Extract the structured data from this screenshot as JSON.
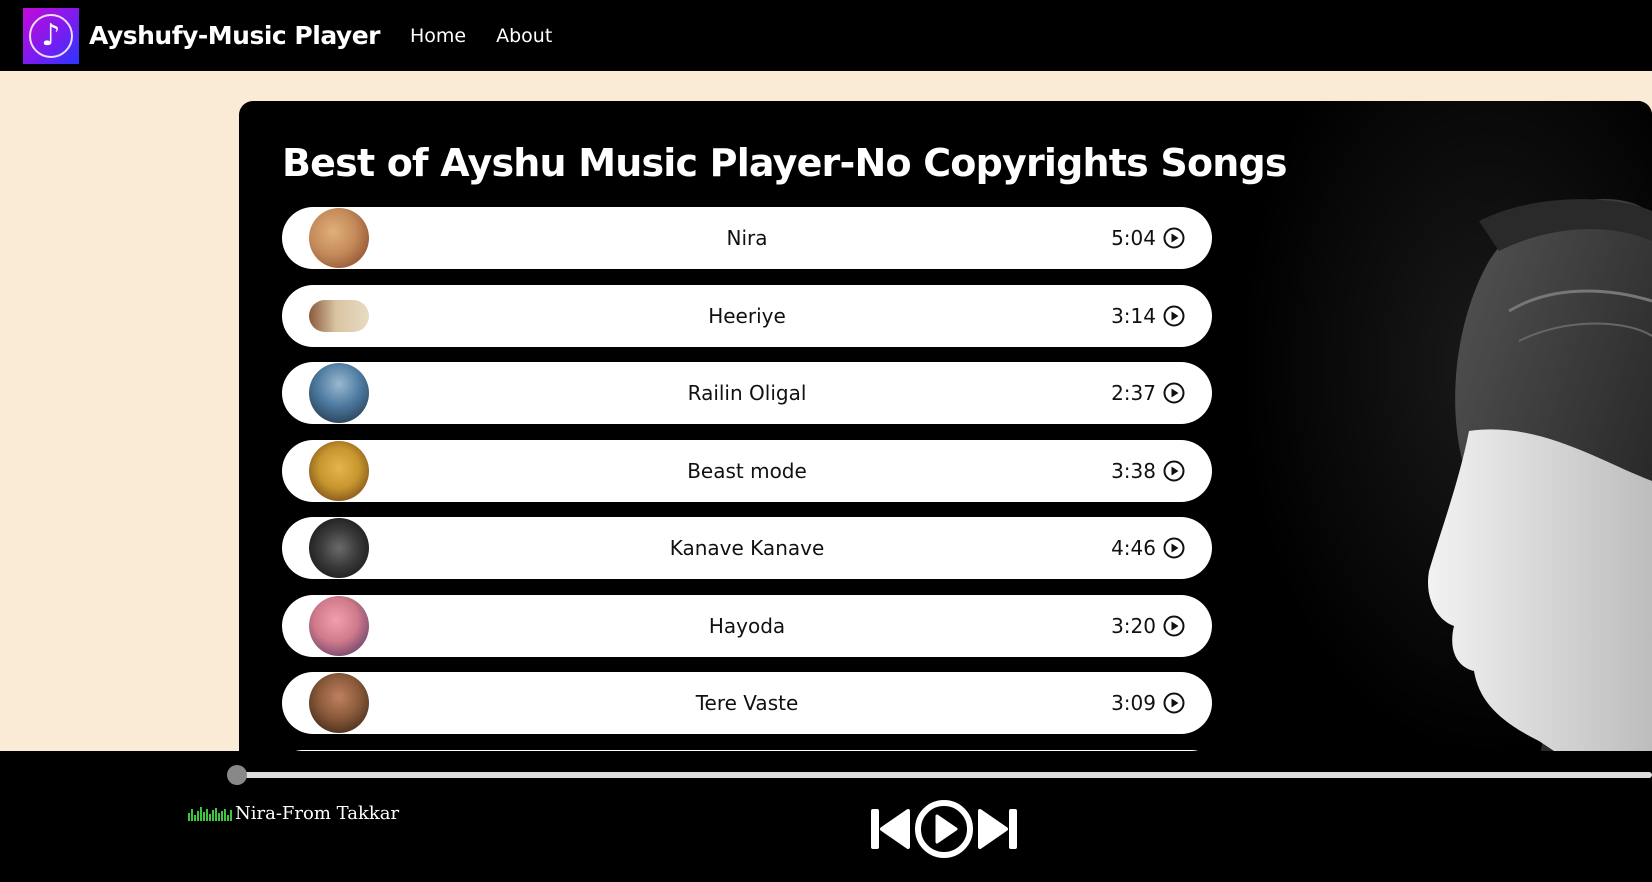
{
  "navbar": {
    "brand": "Ayshufy-Music Player",
    "links": [
      {
        "label": "Home"
      },
      {
        "label": "About"
      }
    ],
    "logo_icon": "music-note-icon"
  },
  "main": {
    "heading": "Best of Ayshu Music Player-No Copyrights Songs",
    "songs": [
      {
        "title": "Nira",
        "duration": "5:04",
        "thumb_colors": [
          "#c48a5a",
          "#7b3a20"
        ]
      },
      {
        "title": "Heeriye",
        "duration": "3:14",
        "thumb_colors": [
          "#d9c4a2",
          "#8a5a3c"
        ]
      },
      {
        "title": "Railin Oligal",
        "duration": "2:37",
        "thumb_colors": [
          "#4d7aa0",
          "#1c2a3a"
        ]
      },
      {
        "title": "Beast mode",
        "duration": "3:38",
        "thumb_colors": [
          "#c8962e",
          "#5a3010"
        ]
      },
      {
        "title": "Kanave Kanave",
        "duration": "4:46",
        "thumb_colors": [
          "#3a3a3a",
          "#0c0c0c"
        ]
      },
      {
        "title": "Hayoda",
        "duration": "3:20",
        "thumb_colors": [
          "#d07a8a",
          "#3a2a60"
        ]
      },
      {
        "title": "Tere Vaste",
        "duration": "3:09",
        "thumb_colors": [
          "#8a5a3a",
          "#2a1a10"
        ]
      }
    ],
    "play_icon": "play-circle-icon"
  },
  "player": {
    "now_playing": "Nira-From Takkar",
    "progress": 0.0,
    "controls": {
      "previous_icon": "skip-back-icon",
      "play_icon": "play-circle-icon",
      "next_icon": "skip-forward-icon"
    },
    "eq_color": "#3ec63e"
  }
}
